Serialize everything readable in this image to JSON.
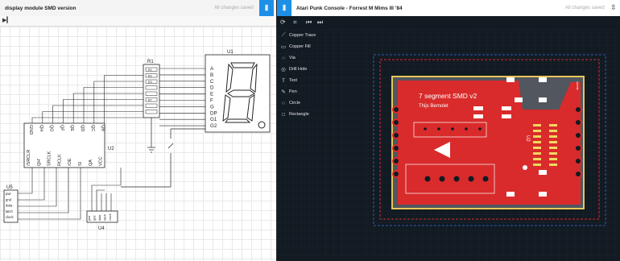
{
  "left_pane": {
    "title": "display module SMD version",
    "saved_status": "All changes saved",
    "play_icon": "▶▎"
  },
  "schematic": {
    "resistor_label": "R1",
    "resistor_rows": [
      "R1",
      "R2",
      "R3",
      "",
      "",
      "R7",
      "",
      ""
    ],
    "display_label": "U1",
    "display_pins": [
      "A",
      "B",
      "C",
      "D",
      "E",
      "F",
      "G",
      "DP",
      "G1",
      "G2"
    ],
    "shift_label": "U2",
    "shift_pins": [
      "GND",
      "QH",
      "QG",
      "QF",
      "QE",
      "QD",
      "QC",
      "QB",
      "/SRCLR",
      "QH'",
      "SRCLK",
      "RCLK",
      "/OE",
      "SI",
      "QA",
      "VCC"
    ],
    "header_left_label": "U5",
    "header_left_pins": [
      "pwr",
      "gnd",
      "data",
      "latch",
      "clock"
    ],
    "header_bottom_label": "U4",
    "header_bottom_pins": [
      "pwr",
      "gnd",
      "data",
      "latch",
      "clock"
    ]
  },
  "right_pane": {
    "title": "Atari Punk Console - Forrest M Mims III '84",
    "saved_status": "All changes saved",
    "tools": [
      {
        "icon": "trace-icon",
        "glyph": "⟋",
        "label": "Copper Trace"
      },
      {
        "icon": "fill-icon",
        "glyph": "▭",
        "label": "Copper Fill"
      },
      {
        "icon": "via-icon",
        "glyph": "○",
        "label": "Via"
      },
      {
        "icon": "drill-icon",
        "glyph": "◎",
        "label": "Drill Hole"
      },
      {
        "icon": "text-icon",
        "glyph": "T",
        "label": "Text"
      },
      {
        "icon": "pen-icon",
        "glyph": "✎",
        "label": "Pen"
      },
      {
        "icon": "circle-icon",
        "glyph": "○",
        "label": "Circle"
      },
      {
        "icon": "rect-icon",
        "glyph": "□",
        "label": "Rectangle"
      }
    ]
  },
  "pcb": {
    "board_title": "7 segment SMD v2",
    "author": "Thijs Bernolet",
    "silk_top": "schmtc",
    "u_label": "U2"
  },
  "colors": {
    "accent_blue": "#1e8fe6",
    "copper_red": "#d92b2b",
    "board_edge": "#e8c65a",
    "pcb_bg": "#121a22"
  }
}
